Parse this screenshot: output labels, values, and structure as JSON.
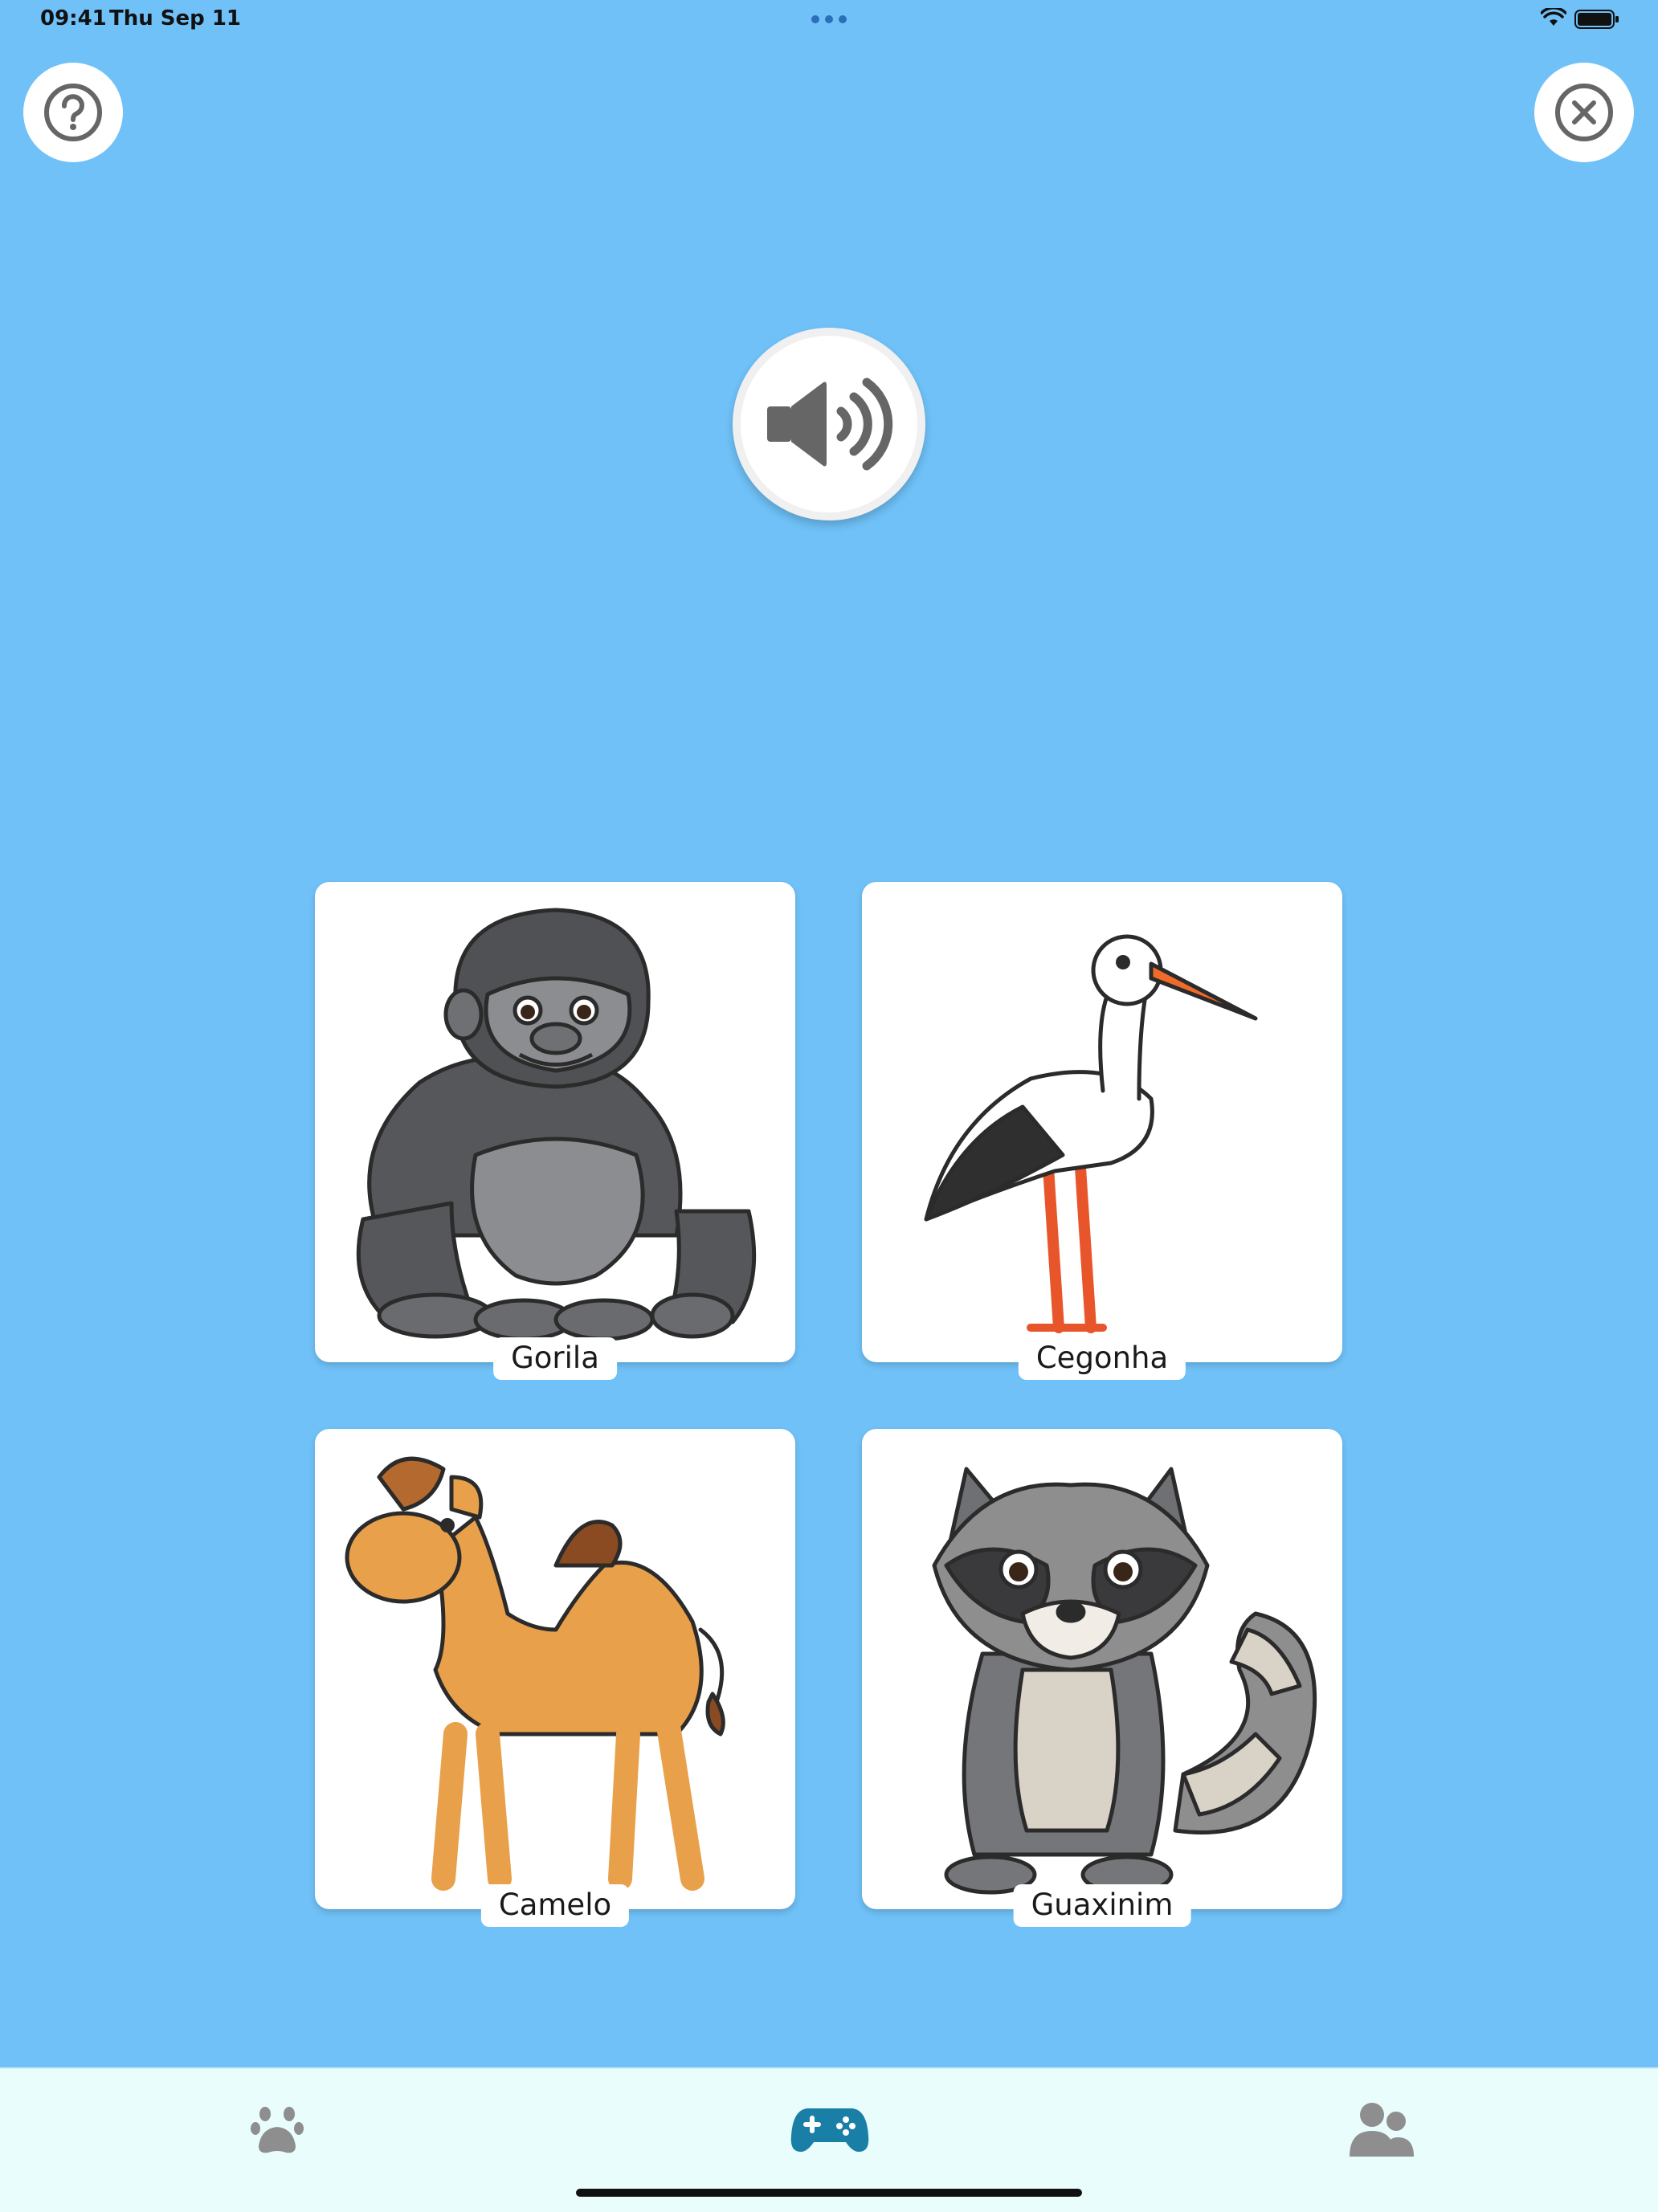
{
  "status_bar": {
    "time": "09:41",
    "date": "Thu Sep 11"
  },
  "header": {
    "help_icon": "question-circle-icon",
    "close_icon": "x-circle-icon"
  },
  "audio": {
    "icon": "speaker-wave-icon"
  },
  "cards": [
    {
      "label": "Gorila",
      "icon": "gorilla-illustration"
    },
    {
      "label": "Cegonha",
      "icon": "stork-illustration"
    },
    {
      "label": "Camelo",
      "icon": "camel-illustration"
    },
    {
      "label": "Guaxinim",
      "icon": "raccoon-illustration"
    }
  ],
  "tab_bar": {
    "tabs": [
      {
        "icon": "paw-icon",
        "active": false
      },
      {
        "icon": "gamepad-icon",
        "active": true
      },
      {
        "icon": "users-icon",
        "active": false
      }
    ],
    "colors": {
      "active": "#1a7fa6",
      "inactive": "#8e8e8e"
    }
  },
  "colors": {
    "background": "#6fc1f7",
    "card": "#ffffff",
    "icon_gray": "#666666"
  }
}
